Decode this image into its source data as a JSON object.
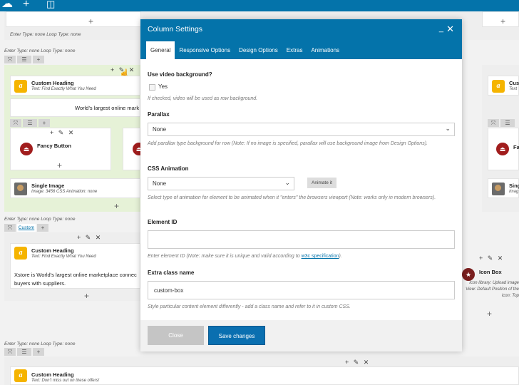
{
  "toolbar": {
    "icons": [
      "logo-icon",
      "plus-icon",
      "layout-icon"
    ]
  },
  "rows": {
    "row1_label": "Enter Type: none  Loop Type: none",
    "row2_label": "Enter Type: none  Loop Type: none",
    "row3_label": "Enter Type: none  Loop Type: none",
    "row4_label": "Enter Type: none  Loop Type: none",
    "custom_tab": "Custom"
  },
  "elements": {
    "custom_heading_title": "Custom Heading",
    "custom_heading_sub": "Text: Find Exactly What You Need",
    "green_text": "World's largest online mark",
    "fancy_button": "Fancy Button",
    "single_image_title": "Single Image",
    "single_image_sub": "Image: 3456  CSS Animation: none",
    "heading2_title": "Custom Heading",
    "heading2_sub": "Text: Find Exactly What You Need",
    "heading2_text": "Xstore is World's largest online marketplace connec buyers with suppliers.",
    "heading3_title": "Custom Heading",
    "heading3_sub": "Text: Don't miss out on these offers!",
    "right_custom": "Cus",
    "right_custom_sub": "Text",
    "right_fa": "Fa",
    "right_single": "Singl",
    "right_image": "Imag",
    "icon_box_title": "Icon Box",
    "icon_box_sub": "Icon library: Upload image  View: Default  Position of the icon: Top"
  },
  "modal": {
    "title": "Column Settings",
    "minimize": "_",
    "close": "✕",
    "tabs": [
      "General",
      "Responsive Options",
      "Design Options",
      "Extras",
      "Animations"
    ],
    "video_label": "Use video background?",
    "video_option": "Yes",
    "video_help": "If checked, video will be used as row background.",
    "parallax_label": "Parallax",
    "parallax_value": "None",
    "parallax_help": "Add parallax type background for row (Note: If no image is specified, parallax will use background image from Design Options).",
    "css_anim_label": "CSS Animation",
    "css_anim_value": "None",
    "animate_button": "Animate it",
    "css_anim_help": "Select type of animation for element to be animated when it \"enters\" the browsers viewport (Note: works only in modern browsers).",
    "element_id_label": "Element ID",
    "element_id_value": "",
    "element_id_help_pre": "Enter element ID (Note: make sure it is unique and valid according to ",
    "element_id_help_link": "w3c specification",
    "element_id_help_post": ").",
    "extra_class_label": "Extra class name",
    "extra_class_value": "custom-box",
    "extra_class_help": "Style particular content element differently - add a class name and refer to it in custom CSS.",
    "close_button": "Close",
    "save_button": "Save changes"
  }
}
